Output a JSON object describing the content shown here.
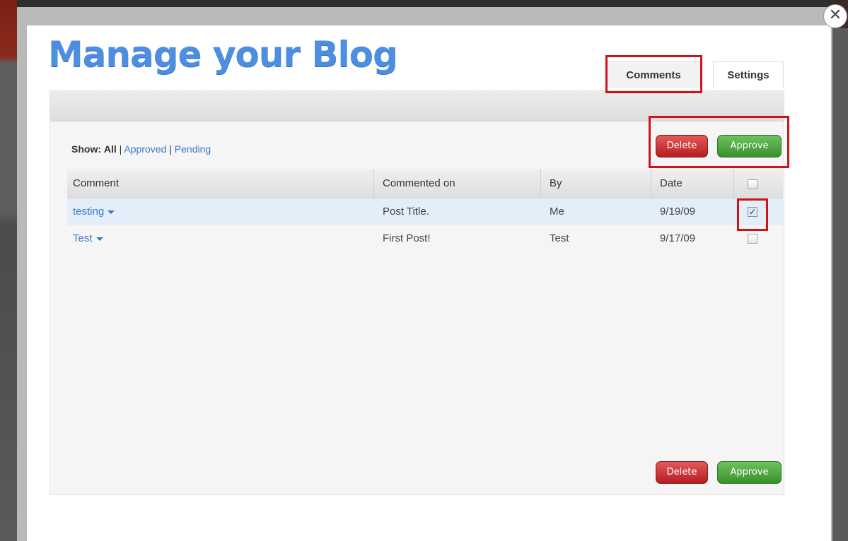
{
  "modal": {
    "title": "Manage your Blog",
    "close_glyph": "✕"
  },
  "tabs": [
    {
      "label": "Comments",
      "active": true
    },
    {
      "label": "Settings",
      "active": false
    }
  ],
  "filter": {
    "label": "Show:",
    "all": "All",
    "separator": "|",
    "approved": "Approved",
    "pending": "Pending"
  },
  "actions": {
    "delete_label": "Delete",
    "approve_label": "Approve"
  },
  "table": {
    "headers": [
      "Comment",
      "Commented on",
      "By",
      "Date"
    ],
    "rows": [
      {
        "comment": "testing",
        "commented_on": "Post Title.",
        "by": "Me",
        "date": "9/19/09",
        "checked": true
      },
      {
        "comment": "Test",
        "commented_on": "First Post!",
        "by": "Test",
        "date": "9/17/09",
        "checked": false
      }
    ]
  },
  "colors": {
    "title": "#4d8ee0",
    "link": "#3a78c7",
    "delete": "#c9282c",
    "approve": "#4fa640",
    "highlight": "#d0131b",
    "selected_row": "#e4eef8"
  },
  "icons": {
    "close": "close-icon",
    "dropdown": "chevron-down-icon"
  }
}
